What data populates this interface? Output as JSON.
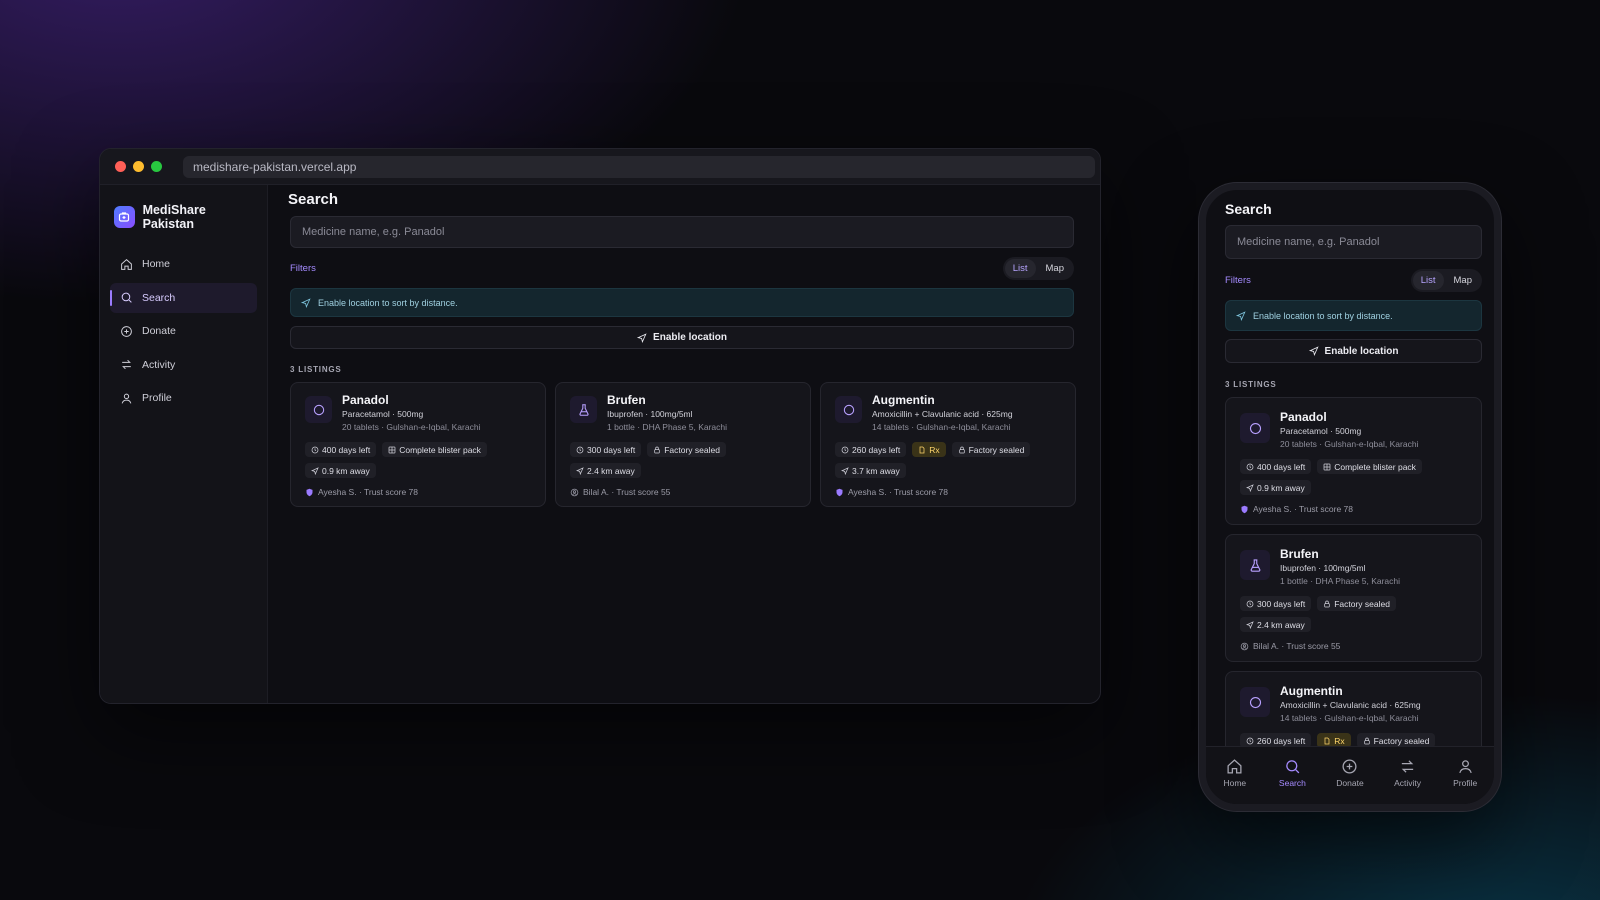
{
  "browser": {
    "url": "medishare-pakistan.vercel.app"
  },
  "brand": {
    "name": "MediShare Pakistan"
  },
  "nav": [
    {
      "label": "Home",
      "icon": "home-icon"
    },
    {
      "label": "Search",
      "icon": "search-icon",
      "active": true
    },
    {
      "label": "Donate",
      "icon": "plus-circle-icon"
    },
    {
      "label": "Activity",
      "icon": "arrows-icon"
    },
    {
      "label": "Profile",
      "icon": "user-icon"
    }
  ],
  "search": {
    "title": "Search",
    "placeholder": "Medicine name, e.g. Panadol",
    "filters_label": "Filters",
    "view_toggle": {
      "list": "List",
      "map": "Map",
      "selected": "List"
    },
    "location_banner": "Enable location to sort by distance.",
    "enable_location_button": "Enable location",
    "count_label": "3 LISTINGS"
  },
  "listings": [
    {
      "name": "Panadol",
      "icon": "pill-icon",
      "subtitle": "Paracetamol · 500mg",
      "meta": "20 tablets · Gulshan-e-Iqbal, Karachi",
      "expiry": "400 days left",
      "condition": "Complete blister pack",
      "rx": "",
      "distance": "0.9 km away",
      "owner": "Ayesha S. · Trust score 78",
      "owner_verified": true
    },
    {
      "name": "Brufen",
      "icon": "flask-icon",
      "subtitle": "Ibuprofen · 100mg/5ml",
      "meta": "1 bottle · DHA Phase 5, Karachi",
      "expiry": "300 days left",
      "condition": "Factory sealed",
      "rx": "",
      "distance": "2.4 km away",
      "owner": "Bilal A. · Trust score 55",
      "owner_verified": false
    },
    {
      "name": "Augmentin",
      "icon": "pill-icon",
      "subtitle": "Amoxicillin + Clavulanic acid · 625mg",
      "meta": "14 tablets · Gulshan-e-Iqbal, Karachi",
      "expiry": "260 days left",
      "condition": "Factory sealed",
      "rx": "Rx",
      "distance": "3.7 km away",
      "owner": "Ayesha S. · Trust score 78",
      "owner_verified": true
    }
  ],
  "tabbar": [
    {
      "label": "Home",
      "icon": "home-icon"
    },
    {
      "label": "Search",
      "icon": "search-icon",
      "active": true
    },
    {
      "label": "Donate",
      "icon": "plus-circle-icon"
    },
    {
      "label": "Activity",
      "icon": "arrows-icon"
    },
    {
      "label": "Profile",
      "icon": "user-icon"
    }
  ],
  "colors": {
    "accent": "#a58bff",
    "rx_badge": "#ffd66b",
    "banner": "#14262e"
  }
}
